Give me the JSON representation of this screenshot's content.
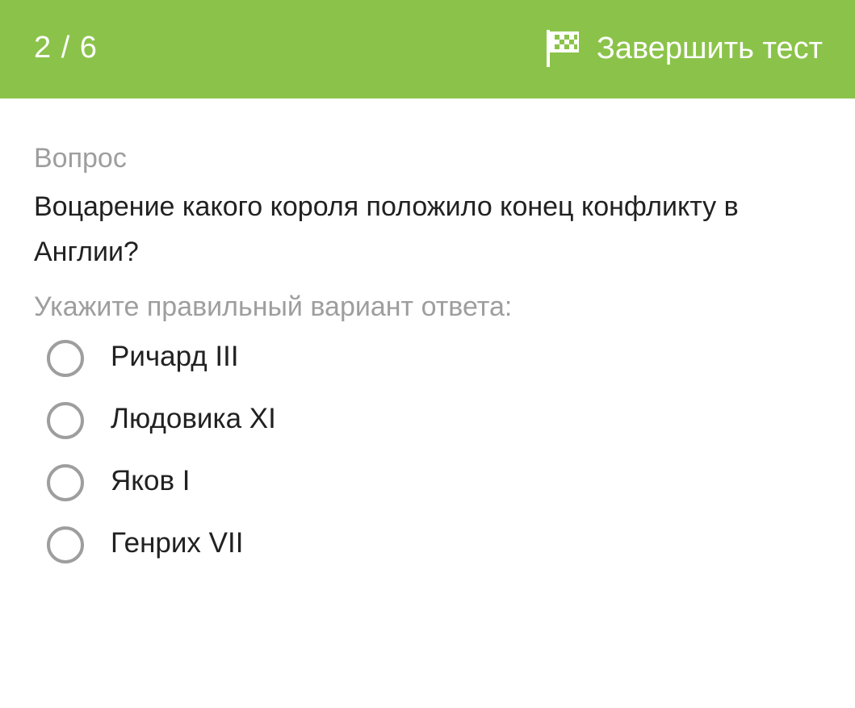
{
  "header": {
    "progress_text": "2 / 6",
    "finish_label": "Завершить тест",
    "finish_icon": "checkered-flag-icon",
    "background_color": "#8bc34a"
  },
  "question": {
    "caption": "Вопрос",
    "text": "Воцарение какого короля положило конец конфликту в Англии?",
    "instruction": "Укажите правильный вариант ответа:"
  },
  "options": [
    {
      "label": "Ричард III",
      "selected": false
    },
    {
      "label": "Людовика XI",
      "selected": false
    },
    {
      "label": "Яков I",
      "selected": false
    },
    {
      "label": "Генрих VII",
      "selected": false
    }
  ]
}
